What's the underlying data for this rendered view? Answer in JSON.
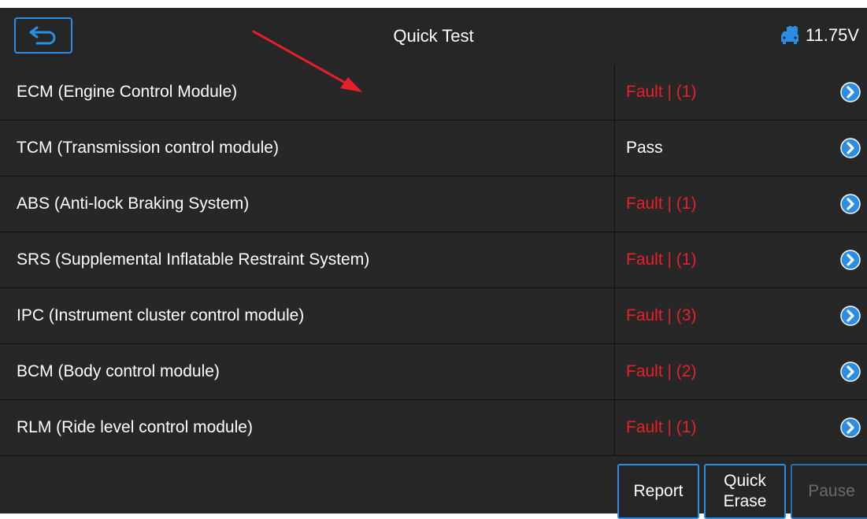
{
  "header": {
    "title": "Quick Test",
    "voltage": "11.75V",
    "back_icon": "back-arrow-icon",
    "battery_icon": "vehicle-battery-icon"
  },
  "colors": {
    "fault": "#e8202a",
    "pass": "#ffffff",
    "accent": "#2b8ee6"
  },
  "modules": [
    {
      "name": "ECM (Engine Control Module)",
      "status": "Fault | (1)",
      "state": "fault"
    },
    {
      "name": "TCM (Transmission control module)",
      "status": "Pass",
      "state": "pass"
    },
    {
      "name": "ABS (Anti-lock Braking System)",
      "status": "Fault | (1)",
      "state": "fault"
    },
    {
      "name": "SRS (Supplemental Inflatable Restraint System)",
      "status": "Fault | (1)",
      "state": "fault"
    },
    {
      "name": "IPC (Instrument cluster control module)",
      "status": "Fault | (3)",
      "state": "fault"
    },
    {
      "name": "BCM (Body control module)",
      "status": "Fault | (2)",
      "state": "fault"
    },
    {
      "name": "RLM (Ride level control module)",
      "status": "Fault | (1)",
      "state": "fault"
    }
  ],
  "footer": {
    "report_label": "Report",
    "quick_erase_line1": "Quick",
    "quick_erase_line2": "Erase",
    "pause_label": "Pause"
  }
}
